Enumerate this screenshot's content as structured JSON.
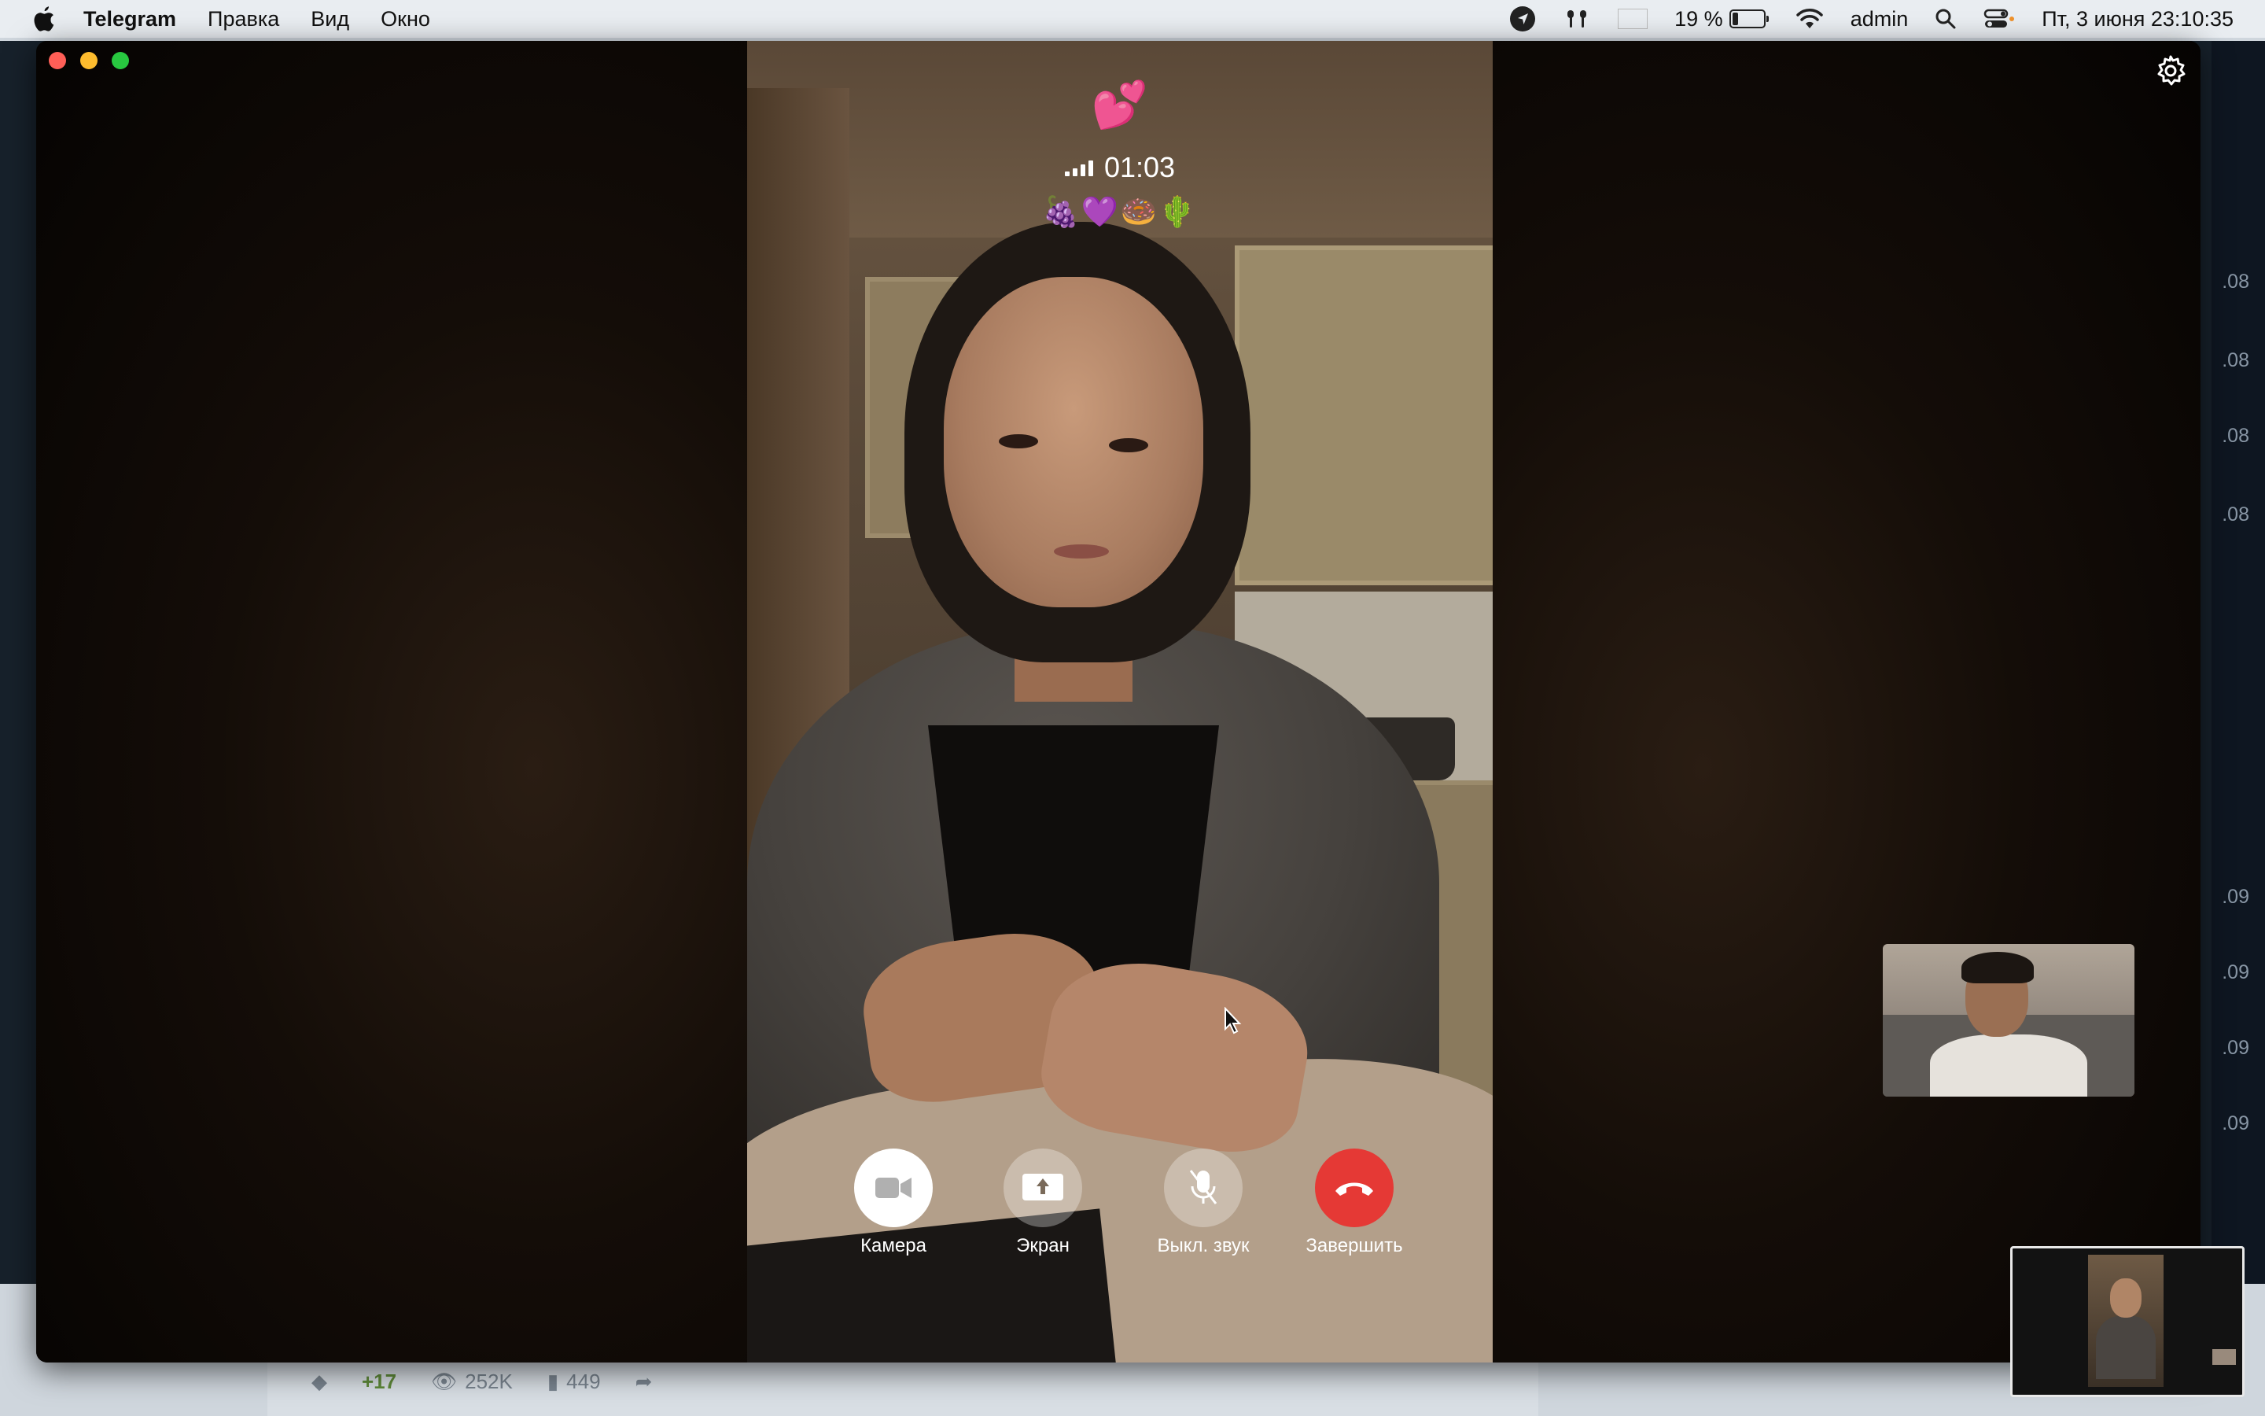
{
  "menubar": {
    "app_name": "Telegram",
    "menus": [
      "Правка",
      "Вид",
      "Окно"
    ],
    "battery_percent": "19 %",
    "battery_level": 0.19,
    "user": "admin",
    "datetime": "Пт, 3 июня  23:10:35",
    "icons": [
      "apple-icon",
      "location-arrow-icon",
      "airpods-icon",
      "russian-flag-icon",
      "battery-icon",
      "wifi-icon",
      "search-icon",
      "control-center-icon"
    ]
  },
  "background_window": {
    "times": [
      ".08",
      ".08",
      ".08",
      ".08",
      ".09",
      ".09",
      ".09",
      ".09"
    ],
    "bottom_bar": {
      "likes": "+17",
      "views": "252K",
      "bookmarks": "449"
    }
  },
  "call": {
    "reaction_emoji": "💕",
    "duration": "01:03",
    "encryption_emojis": "🍇💜🍩🌵",
    "signal_bars": 4,
    "controls": [
      {
        "id": "camera",
        "label": "Камера",
        "icon": "video-camera-icon",
        "bg": "#ffffff"
      },
      {
        "id": "screen",
        "label": "Экран",
        "icon": "screen-share-icon",
        "bg": "#ffffff4d"
      },
      {
        "id": "mute",
        "label": "Выкл. звук",
        "icon": "microphone-off-icon",
        "bg": "#ffffff4d"
      },
      {
        "id": "end",
        "label": "Завершить",
        "icon": "hang-up-icon",
        "bg": "#e53935"
      }
    ]
  },
  "colors": {
    "end_call": "#e53935",
    "close": "#ff5f57",
    "minimize": "#febc2e",
    "maximize": "#28c840"
  }
}
